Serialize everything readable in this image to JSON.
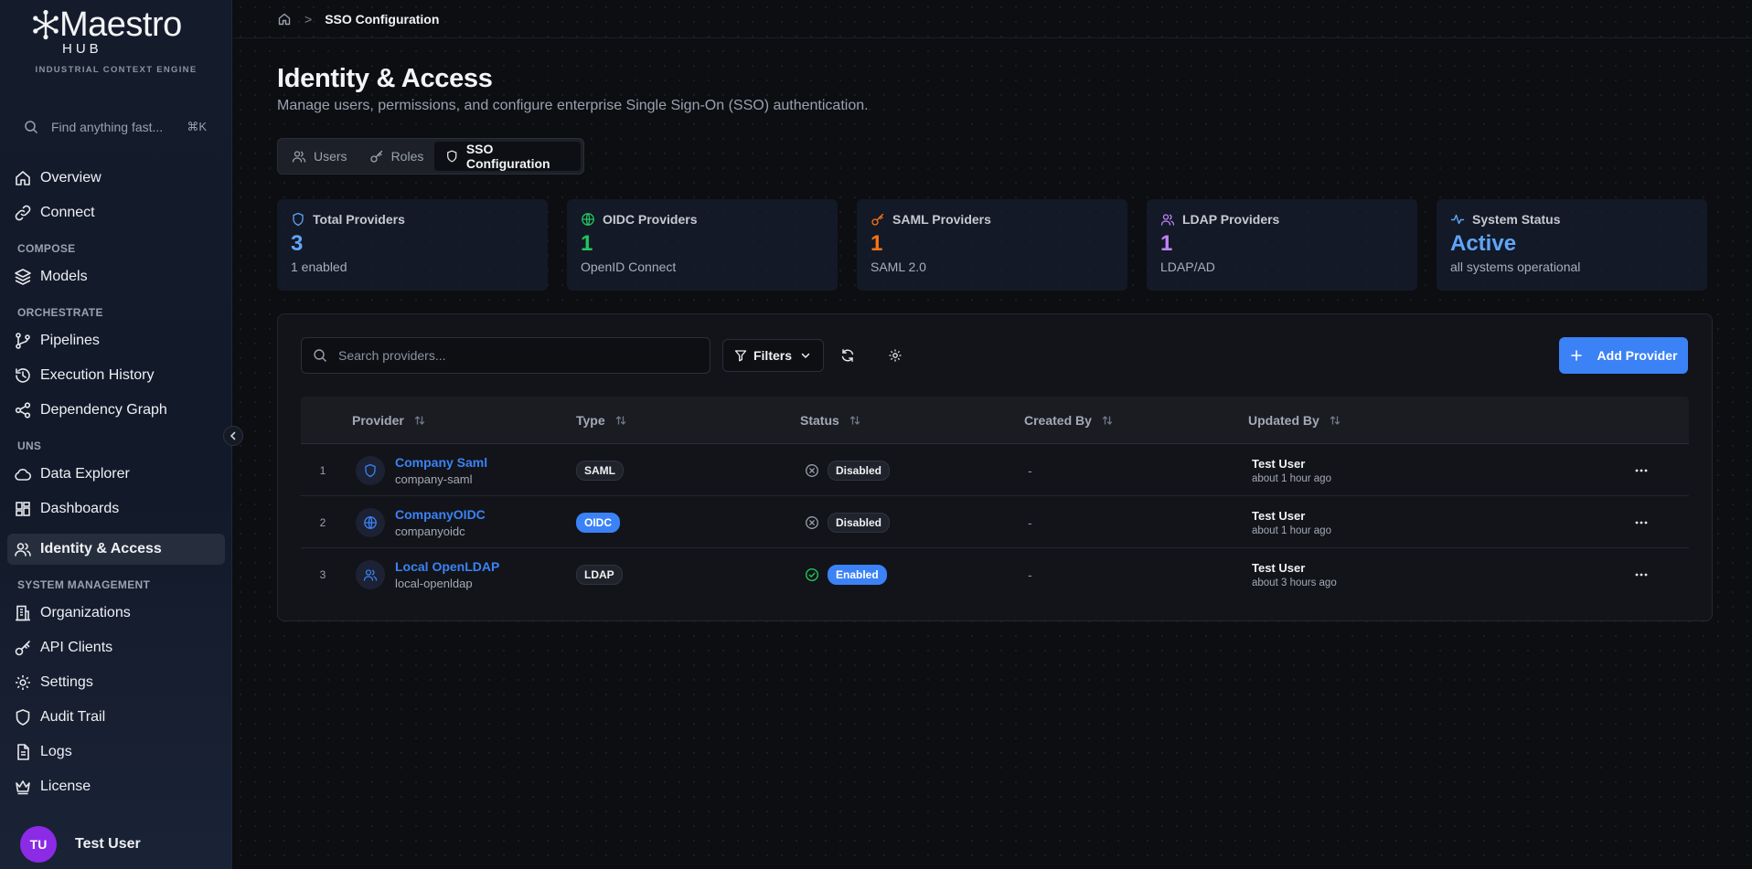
{
  "brand": {
    "name": "Maestro",
    "sub": "HUB",
    "tagline": "INDUSTRIAL CONTEXT ENGINE"
  },
  "sidebar": {
    "search_placeholder": "Find anything fast...",
    "search_shortcut": "⌘K",
    "items": {
      "overview": "Overview",
      "connect": "Connect",
      "models": "Models",
      "pipelines": "Pipelines",
      "execution_history": "Execution History",
      "dependency_graph": "Dependency Graph",
      "data_explorer": "Data Explorer",
      "dashboards": "Dashboards",
      "identity_access": "Identity & Access",
      "organizations": "Organizations",
      "api_clients": "API Clients",
      "settings": "Settings",
      "audit_trail": "Audit Trail",
      "logs": "Logs",
      "license": "License"
    },
    "sections": {
      "compose": "COMPOSE",
      "orchestrate": "ORCHESTRATE",
      "uns": "UNS",
      "system_management": "SYSTEM MANAGEMENT"
    },
    "user": {
      "initials": "TU",
      "name": "Test User"
    }
  },
  "breadcrumb": {
    "separator": ">",
    "current": "SSO Configuration"
  },
  "header": {
    "title": "Identity & Access",
    "subtitle": "Manage users, permissions, and configure enterprise Single Sign-On (SSO) authentication."
  },
  "tabs": [
    {
      "label": "Users",
      "icon": "users-icon"
    },
    {
      "label": "Roles",
      "icon": "key-icon"
    },
    {
      "label": "SSO Configuration",
      "icon": "shield-icon",
      "active": true
    }
  ],
  "stats": [
    {
      "label": "Total Providers",
      "value": "3",
      "sub": "1 enabled",
      "color": "#60a5fa"
    },
    {
      "label": "OIDC Providers",
      "value": "1",
      "sub": "OpenID Connect",
      "color": "#22c55e"
    },
    {
      "label": "SAML Providers",
      "value": "1",
      "sub": "SAML 2.0",
      "color": "#f97316"
    },
    {
      "label": "LDAP Providers",
      "value": "1",
      "sub": "LDAP/AD",
      "color": "#c084fc"
    },
    {
      "label": "System Status",
      "value": "Active",
      "sub": "all systems operational",
      "color": "#60a5fa"
    }
  ],
  "toolbar": {
    "search_placeholder": "Search providers...",
    "filters_label": "Filters",
    "add_label": "Add Provider"
  },
  "table": {
    "columns": [
      "Provider",
      "Type",
      "Status",
      "Created By",
      "Updated By"
    ],
    "rows": [
      {
        "num": "1",
        "name": "Company Saml",
        "slug": "company-saml",
        "type": "SAML",
        "status": "Disabled",
        "created_by": "-",
        "updated_by": "Test User",
        "updated_at": "about 1 hour ago",
        "icon": "shield-icon"
      },
      {
        "num": "2",
        "name": "CompanyOIDC",
        "slug": "companyoidc",
        "type": "OIDC",
        "status": "Disabled",
        "created_by": "-",
        "updated_by": "Test User",
        "updated_at": "about 1 hour ago",
        "icon": "globe-icon"
      },
      {
        "num": "3",
        "name": "Local OpenLDAP",
        "slug": "local-openldap",
        "type": "LDAP",
        "status": "Enabled",
        "created_by": "-",
        "updated_by": "Test User",
        "updated_at": "about 3 hours ago",
        "icon": "users-icon"
      }
    ]
  },
  "colors": {
    "accent": "#3b82f6",
    "avatar": "#8b2be6",
    "enabled": "#22c55e"
  }
}
